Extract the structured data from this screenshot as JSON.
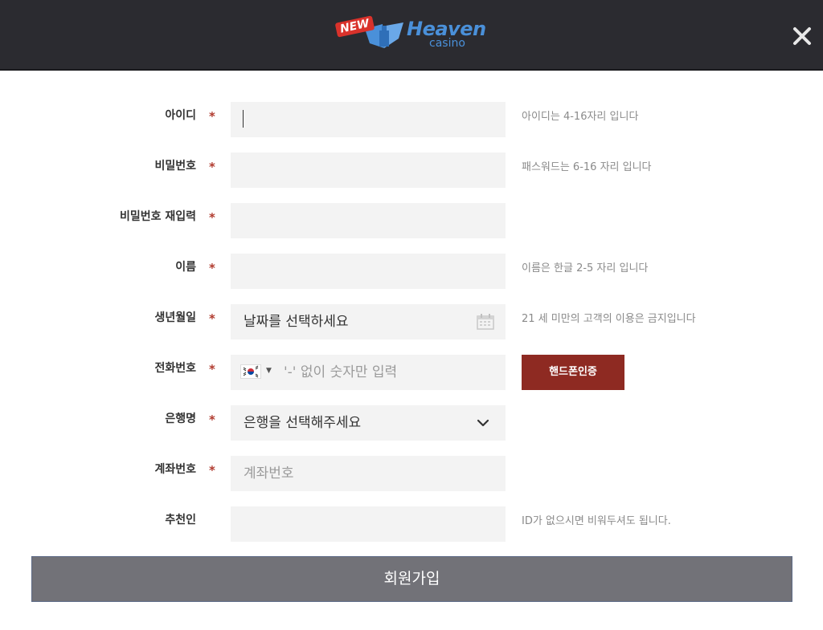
{
  "header": {
    "logo": {
      "new": "NEW",
      "brand": "Heaven",
      "sub": "casino"
    },
    "close_icon": "close-icon"
  },
  "form": {
    "user_id": {
      "label": "아이디",
      "required": "*",
      "value": "",
      "hint": "아이디는 4-16자리 입니다"
    },
    "password": {
      "label": "비밀번호",
      "required": "*",
      "value": "",
      "hint": "패스워드는 6-16 자리 입니다"
    },
    "password_confirm": {
      "label": "비밀번호 재입력",
      "required": "*",
      "value": ""
    },
    "name": {
      "label": "이름",
      "required": "*",
      "value": "",
      "hint": "이름은 한글 2-5 자리 입니다"
    },
    "birthdate": {
      "label": "생년월일",
      "required": "*",
      "placeholder": "날짜를 선택하세요",
      "hint": "21 세 미만의 고객의 이용은 금지입니다",
      "icon": "calendar-icon"
    },
    "phone": {
      "label": "전화번호",
      "required": "*",
      "country_flag": "kr-flag-icon",
      "placeholder": "'-' 없이 숫자만 입력",
      "verify_button": "핸드폰인증"
    },
    "bank": {
      "label": "은행명",
      "required": "*",
      "selected": "은행을 선택해주세요",
      "icon": "chevron-down-icon"
    },
    "account": {
      "label": "계좌번호",
      "required": "*",
      "placeholder": "계좌번호"
    },
    "referrer": {
      "label": "추천인",
      "value": "",
      "hint": "ID가 없으시면 비워두셔도 됩니다."
    }
  },
  "submit_label": "회원가입",
  "colors": {
    "header_bg": "#2b2b30",
    "field_bg": "#f3f3f3",
    "required_star": "#b03a2e",
    "verify_button": "#8e2a22",
    "submit_bg": "#727278",
    "logo_blue": "#4a90d9"
  }
}
